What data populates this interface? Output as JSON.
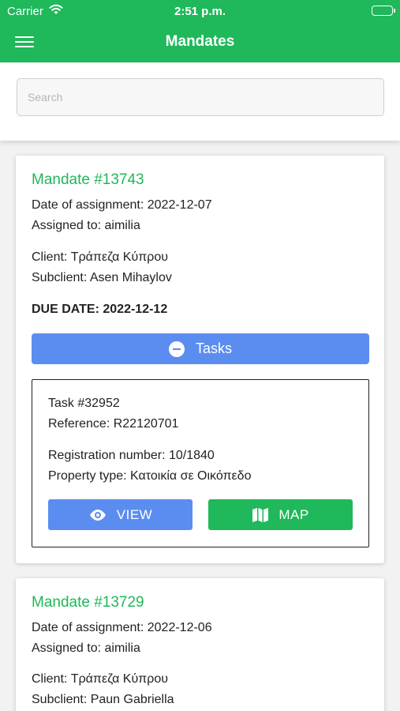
{
  "status_bar": {
    "carrier": "Carrier",
    "time": "2:51 p.m."
  },
  "app_bar": {
    "title": "Mandates"
  },
  "search": {
    "placeholder": "Search",
    "value": ""
  },
  "mandates": [
    {
      "title": "Mandate #13743",
      "date_of_assignment": "Date of assignment: 2022-12-07",
      "assigned_to": "Assigned to: aimilia",
      "client": "Client: Τράπεζα Κύπρου",
      "subclient": "Subclient: Asen Mihaylov",
      "due_date": "DUE DATE: 2022-12-12",
      "tasks_label": "Tasks",
      "tasks": [
        {
          "title": "Task #32952",
          "reference": "Reference: R22120701",
          "registration_number": "Registration number: 10/1840",
          "property_type": "Property type: Κατοικία σε Οικόπεδο",
          "view_label": "VIEW",
          "map_label": "MAP"
        }
      ]
    },
    {
      "title": "Mandate #13729",
      "date_of_assignment": "Date of assignment: 2022-12-06",
      "assigned_to": "Assigned to: aimilia",
      "client": "Client: Τράπεζα Κύπρου",
      "subclient": "Subclient: Paun Gabriella"
    }
  ],
  "icons": {
    "wifi": "wifi-icon",
    "battery": "battery-icon",
    "menu": "hamburger-menu-icon",
    "tasks_toggle": "minus-circle-icon",
    "view": "eye-icon",
    "map": "map-icon"
  },
  "colors": {
    "brand_green": "#1fb85a",
    "accent_blue": "#5b8df0"
  }
}
